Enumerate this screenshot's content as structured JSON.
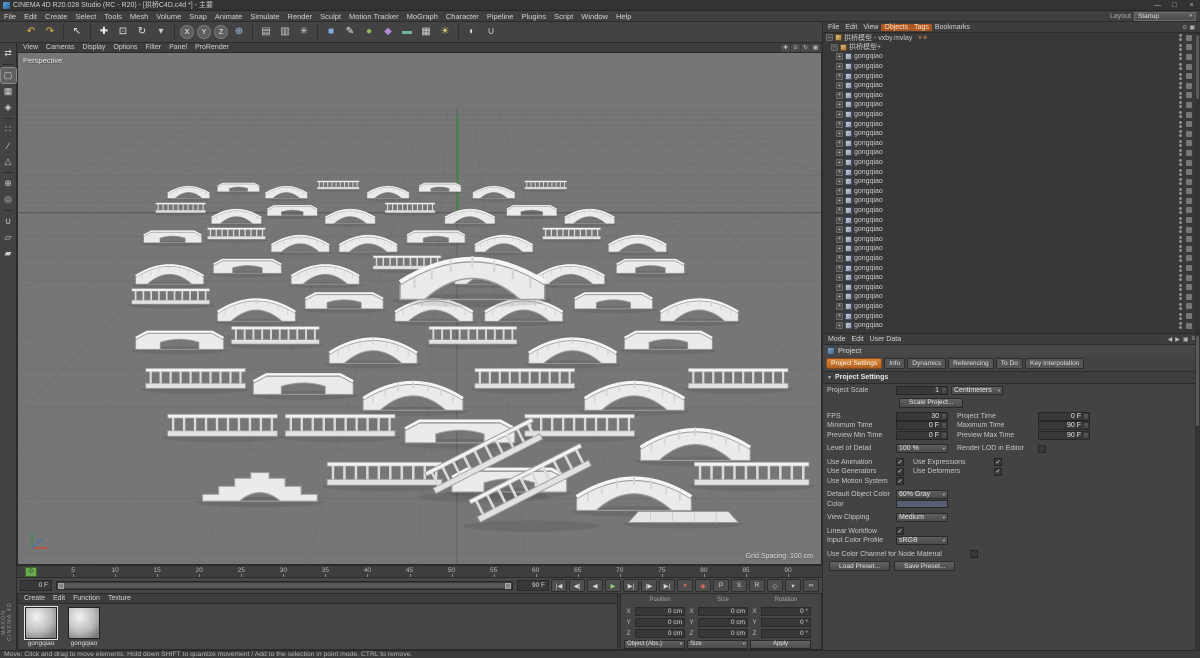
{
  "window": {
    "title": "CINEMA 4D R20.028 Studio (RC - R20) - [拱桥C4D.c4d *] - 主要",
    "min": "—",
    "max": "□",
    "close": "×"
  },
  "menubar": {
    "items": [
      "File",
      "Edit",
      "Create",
      "Select",
      "Tools",
      "Mesh",
      "Volume",
      "Snap",
      "Animate",
      "Simulate",
      "Render",
      "Sculpt",
      "Motion Tracker",
      "MoGraph",
      "Character",
      "Pipeline",
      "Plugins",
      "Script",
      "Window",
      "Help"
    ],
    "layout_label": "Layout",
    "layout_value": "Startup"
  },
  "toolbar": {
    "icons": [
      {
        "n": "undo-icon",
        "g": "↶",
        "c": "#e3bd4e"
      },
      {
        "n": "redo-icon",
        "g": "↷",
        "c": "#e3bd4e"
      },
      {
        "sep": true
      },
      {
        "n": "live-selection-icon",
        "g": "↖",
        "c": "#e8e8e8"
      },
      {
        "sep": true
      },
      {
        "n": "move-icon",
        "g": "✚",
        "c": "#e8e8e8"
      },
      {
        "n": "scale-icon",
        "g": "⊡",
        "c": "#e8e8e8"
      },
      {
        "n": "rotate-icon",
        "g": "↻",
        "c": "#e8e8e8"
      },
      {
        "n": "last-used-tool-icon",
        "g": "▾",
        "c": "#cccccc"
      },
      {
        "sep": true
      },
      {
        "n": "lock-x-axis-icon",
        "g": "X",
        "circle": true
      },
      {
        "n": "lock-y-axis-icon",
        "g": "Y",
        "circle": true
      },
      {
        "n": "lock-z-axis-icon",
        "g": "Z",
        "circle": true
      },
      {
        "n": "coordinate-system-icon",
        "g": "⊕",
        "c": "#9fc3e8"
      },
      {
        "sep": true
      },
      {
        "n": "render-view-icon",
        "g": "▤",
        "c": "#cfcfcf"
      },
      {
        "n": "render-picture-viewer-icon",
        "g": "▥",
        "c": "#cfcfcf"
      },
      {
        "n": "render-settings-icon",
        "g": "✳",
        "c": "#cfcfcf"
      },
      {
        "sep": true
      },
      {
        "n": "add-cube-icon",
        "g": "■",
        "c": "#7fb2e0"
      },
      {
        "n": "add-spline-icon",
        "g": "✎",
        "c": "#e8e8e8"
      },
      {
        "n": "add-generator-icon",
        "g": "●",
        "c": "#8ec45f"
      },
      {
        "n": "add-deformer-icon",
        "g": "◆",
        "c": "#b08ad6"
      },
      {
        "n": "add-environment-icon",
        "g": "▬",
        "c": "#6fb3a0"
      },
      {
        "n": "add-camera-icon",
        "g": "▦",
        "c": "#cfcfcf"
      },
      {
        "n": "add-light-icon",
        "g": "☀",
        "c": "#e8d07a"
      },
      {
        "sep": true
      },
      {
        "n": "display-mode-icon",
        "g": "◐",
        "c": "#cfcfcf"
      },
      {
        "n": "snap-settings-icon",
        "g": "∪",
        "c": "#cfcfcf"
      }
    ]
  },
  "mode_toolbar": {
    "icons": [
      {
        "n": "make-editable-icon",
        "g": "⇄"
      },
      {
        "sep": true
      },
      {
        "n": "model-mode-icon",
        "g": "▢",
        "active": true
      },
      {
        "n": "texture-mode-icon",
        "g": "▦"
      },
      {
        "n": "workplane-mode-icon",
        "g": "◈"
      },
      {
        "sep": true
      },
      {
        "n": "points-mode-icon",
        "g": "∷"
      },
      {
        "n": "edges-mode-icon",
        "g": "∕"
      },
      {
        "n": "polygons-mode-icon",
        "g": "△"
      },
      {
        "sep": true
      },
      {
        "n": "enable-axis-icon",
        "g": "⊕"
      },
      {
        "n": "viewport-solo-icon",
        "g": "◎"
      },
      {
        "sep": true
      },
      {
        "n": "enable-snap-icon",
        "g": "∪"
      },
      {
        "n": "workplane-icon",
        "g": "▱"
      },
      {
        "n": "locked-workplane-icon",
        "g": "▰"
      }
    ]
  },
  "viewport": {
    "menus": [
      "View",
      "Cameras",
      "Display",
      "Options",
      "Filter",
      "Panel",
      "ProRender"
    ],
    "label": "Perspective",
    "grid_spacing": "Grid Spacing: 100 cm",
    "view_icons": [
      {
        "n": "pan-view-icon",
        "g": "✚"
      },
      {
        "n": "zoom-view-icon",
        "g": "⊙"
      },
      {
        "n": "rotate-view-icon",
        "g": "↻"
      },
      {
        "n": "toggle-views-icon",
        "g": "▦"
      }
    ]
  },
  "objects_panel": {
    "menus": [
      "File",
      "Edit",
      "View",
      "Objects",
      "Tags",
      "Bookmarks"
    ],
    "highlight": [
      "Objects",
      "Tags"
    ],
    "panel_icons": [
      {
        "n": "om-search-icon",
        "g": "⊙"
      },
      {
        "n": "om-lock-icon",
        "g": "▣"
      }
    ],
    "root_row": {
      "label": "拱桥模型 - vxby.mvlay",
      "badge": "v e"
    },
    "group_row": {
      "label": "拱桥模型+"
    },
    "item_rows": [
      "gongqiao",
      "gongqiao",
      "gongqiao",
      "gongqiao",
      "gongqiao",
      "gongqiao",
      "gongqiao",
      "gongqiao",
      "gongqiao",
      "gongqiao",
      "gongqiao",
      "gongqiao",
      "gongqiao",
      "gongqiao",
      "gongqiao",
      "gongqiao",
      "gongqiao",
      "gongqiao",
      "gongqiao",
      "gongqiao",
      "gongqiao",
      "gongqiao",
      "gongqiao",
      "gongqiao",
      "gongqiao",
      "gongqiao",
      "gongqiao",
      "gongqiao",
      "gongqiao"
    ]
  },
  "attributes": {
    "mode_menu": [
      "Mode",
      "Edit",
      "User Data"
    ],
    "nav_icons": [
      {
        "n": "history-back-icon",
        "g": "◀"
      },
      {
        "n": "history-forward-icon",
        "g": "▶"
      },
      {
        "n": "am-lock-icon",
        "g": "▣"
      },
      {
        "n": "am-menu-icon",
        "g": "≡"
      }
    ],
    "object_label": "Project",
    "tabs": [
      "Project Settings",
      "Info",
      "Dynamics",
      "Referencing",
      "To Do",
      "Key Interpolation"
    ],
    "active_tab": "Project Settings",
    "section": "Project Settings",
    "rows": [
      {
        "l": "Project Scale",
        "c": {
          "num": "1"
        },
        "c2": {
          "combo": "Centimeters"
        }
      },
      {
        "buttons": [
          "Scale Project..."
        ],
        "indent": 72
      },
      {
        "l": "FPS",
        "c": {
          "num": "30"
        },
        "l2": "Project Time",
        "c2": {
          "num": "0 F"
        },
        "gap": true
      },
      {
        "l": "Minimum Time",
        "c": {
          "num": "0 F"
        },
        "l2": "Maximum Time",
        "c2": {
          "num": "90 F"
        }
      },
      {
        "l": "Preview Min Time",
        "c": {
          "num": "0 F"
        },
        "l2": "Preview Max Time",
        "c2": {
          "num": "90 F"
        }
      },
      {
        "l": "Level of Detail",
        "c": {
          "combo": "100 %"
        },
        "l2": "Render LOD in Editor",
        "c2": {
          "check": false
        },
        "gap": true
      },
      {
        "l": "Use Animation",
        "c": {
          "check": true
        },
        "l2": "Use Expressions",
        "c2": {
          "check": true
        },
        "gap": true
      },
      {
        "l": "Use Generators",
        "c": {
          "check": true
        },
        "l2": "Use Deformers",
        "c2": {
          "check": true
        }
      },
      {
        "l": "Use Motion System",
        "c": {
          "check": true
        }
      },
      {
        "l": "Default Object Color",
        "c": {
          "combo": "60% Gray"
        },
        "gap": true
      },
      {
        "l": "Color",
        "c": {
          "swatch": "#566070"
        }
      },
      {
        "l": "View Clipping",
        "c": {
          "combo": "Medium"
        },
        "gap": true
      },
      {
        "l": "Linear Workflow",
        "c": {
          "check": true
        },
        "gap": true
      },
      {
        "l": "Input Color Profile",
        "c": {
          "combo": "sRGB"
        }
      },
      {
        "l": "Use Color Channel for Node Material",
        "c": {
          "check": false
        },
        "wide": true,
        "gap": true
      },
      {
        "buttons": [
          "Load Preset...",
          "Save Preset..."
        ],
        "indent": 2,
        "gap": true
      }
    ]
  },
  "timeline": {
    "ticks": [
      0,
      5,
      10,
      15,
      20,
      25,
      30,
      35,
      40,
      45,
      50,
      55,
      60,
      65,
      70,
      75,
      80,
      85,
      90
    ],
    "playhead": "0",
    "current_frame": "0 F",
    "end_frame": "90 F",
    "transport": [
      {
        "n": "goto-start-button",
        "g": "|◀"
      },
      {
        "n": "prev-key-button",
        "g": "◀|"
      },
      {
        "n": "prev-frame-button",
        "g": "◀"
      },
      {
        "n": "play-forward-button",
        "g": "▶",
        "cls": "play"
      },
      {
        "n": "next-frame-button",
        "g": "▶|"
      },
      {
        "n": "next-key-button",
        "g": "|▶"
      },
      {
        "n": "goto-end-button",
        "g": "▶|"
      },
      {
        "n": "record-keyframe-button",
        "g": "●",
        "cls": "rec"
      },
      {
        "n": "autokey-button",
        "g": "◉",
        "cls": "rec"
      },
      {
        "n": "record-position-button",
        "g": "P"
      },
      {
        "n": "record-scale-button",
        "g": "S"
      },
      {
        "n": "record-rotation-button",
        "g": "R"
      },
      {
        "n": "record-parameter-button",
        "g": "◇"
      },
      {
        "n": "keyframe-selection-button",
        "g": "▾"
      },
      {
        "n": "playback-options-button",
        "g": "∞"
      }
    ]
  },
  "materials": {
    "menus": [
      "Create",
      "Edit",
      "Function",
      "Texture"
    ],
    "items": [
      {
        "name": "gongqiao",
        "selected": true
      },
      {
        "name": "gongqiao",
        "selected": false
      }
    ]
  },
  "coordinates": {
    "headers": [
      "Position",
      "Size",
      "Rotation"
    ],
    "axis": [
      "X",
      "Y",
      "Z"
    ],
    "position": [
      "0 cm",
      "0 cm",
      "0 cm"
    ],
    "size": [
      "0 cm",
      "0 cm",
      "0 cm"
    ],
    "rotation": [
      "0 °",
      "0 °",
      "0 °"
    ],
    "mode_combo": "Object (Abs.)",
    "size_combo": "Size",
    "apply_label": "Apply"
  },
  "brand": "MAXON CINEMA 4D",
  "status": "Move: Click and drag to move elements. Hold down SHIFT to quantize movement / Add to the selection in point mode, CTRL to remove."
}
